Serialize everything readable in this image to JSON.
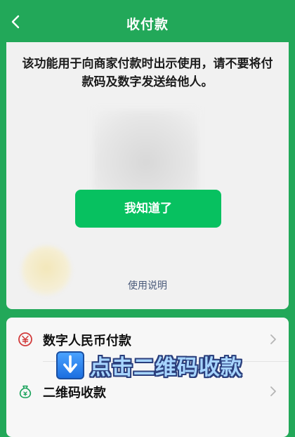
{
  "header": {
    "title": "收付款",
    "back_icon": "chevron-left-icon"
  },
  "notice": {
    "text": "该功能用于向商家付款时出示使用，请不要将付款码及数字发送给他人。"
  },
  "confirm_button": {
    "label": "我知道了"
  },
  "usage_link": {
    "label": "使用说明"
  },
  "payment_options": [
    {
      "label": "数字人民币付款",
      "icon": "digital-rmb-icon"
    },
    {
      "label": "二维码收款",
      "icon": "qr-receive-icon"
    }
  ],
  "overlay": {
    "text": "点击二维码收款",
    "icon": "down-arrow-icon"
  },
  "colors": {
    "header_bg": "#22a859",
    "primary_button": "#07c160",
    "link": "#4a5a7a",
    "rmb_icon": "#d23b3b"
  }
}
